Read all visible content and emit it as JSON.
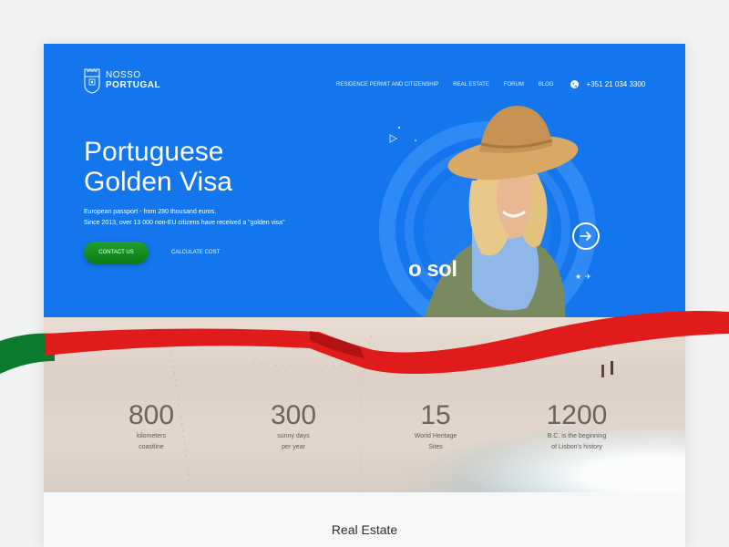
{
  "header": {
    "logo_line1": "NOSSO",
    "logo_line2": "PORTUGAL",
    "nav": [
      {
        "label": "Residence permit and citizenship"
      },
      {
        "label": "Real estate"
      },
      {
        "label": "Forum"
      },
      {
        "label": "Blog"
      }
    ],
    "phone": "+351 21 034 3300"
  },
  "hero": {
    "title_line1": "Portuguese",
    "title_line2": "Golden Visa",
    "subtitle_line1": "European passport - from 280 thousand euros.",
    "subtitle_line2": "Since 2013, over 13 000 non-EU citizens have received a \"golden visa\"",
    "contact_button": "Contact us",
    "calc_button": "Calculate cost",
    "tagline": "o sol"
  },
  "stats": [
    {
      "number": "800",
      "line1": "kilometers",
      "line2": "coastline"
    },
    {
      "number": "300",
      "line1": "sunny days",
      "line2": "per year"
    },
    {
      "number": "15",
      "line1": "World Heritage",
      "line2": "Sites"
    },
    {
      "number": "1200",
      "line1": "B.C. is the beginning",
      "line2": "of Lisbon's history"
    }
  ],
  "section": {
    "title": "Real Estate"
  },
  "colors": {
    "hero_blue": "#1476ec",
    "button_green": "#1a9324",
    "ribbon_red": "#e01b1b",
    "flag_green": "#0b7a2c"
  },
  "icons": [
    "castle-logo-icon",
    "phone-icon",
    "arrow-right-icon",
    "star-icon",
    "plane-icon",
    "play-icon"
  ]
}
